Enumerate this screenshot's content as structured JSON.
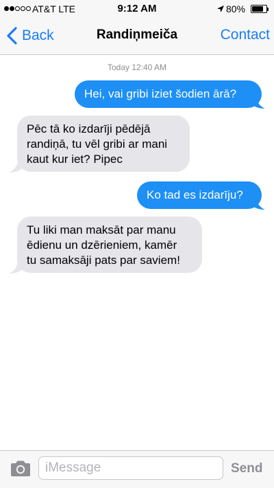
{
  "status_bar": {
    "carrier": "AT&T LTE",
    "time": "9:12 AM",
    "battery": "80%",
    "battery_level": 0.8,
    "signal_bars_filled": 2,
    "signal_bars_total": 5
  },
  "nav": {
    "back_label": "Back",
    "title": "Randiņmeiča",
    "contact_label": "Contact"
  },
  "conversation": {
    "timestamp": "Today 12:40 AM",
    "messages": [
      {
        "direction": "out",
        "text": "Hei, vai gribi iziet šodien ārā?"
      },
      {
        "direction": "in",
        "text": "Pēc tā ko izdarīji pēdējā\nrandiņā, tu vēl gribi ar mani\nkaut kur iet? Pipec"
      },
      {
        "direction": "out",
        "text": "Ko tad es izdarīju?"
      },
      {
        "direction": "in",
        "text": "Tu liki man maksāt par manu\nēdienu un dzērieniem, kamēr\ntu samaksāji pats par saviem!"
      }
    ]
  },
  "input_bar": {
    "placeholder": "iMessage",
    "value": "",
    "send_label": "Send"
  },
  "colors": {
    "accent": "#1a7cf5",
    "outgoing_bubble": "#1d8ff5",
    "incoming_bubble": "#e5e5ea"
  },
  "icons": [
    "location-arrow-icon",
    "battery-icon",
    "chevron-left-icon",
    "camera-icon"
  ]
}
